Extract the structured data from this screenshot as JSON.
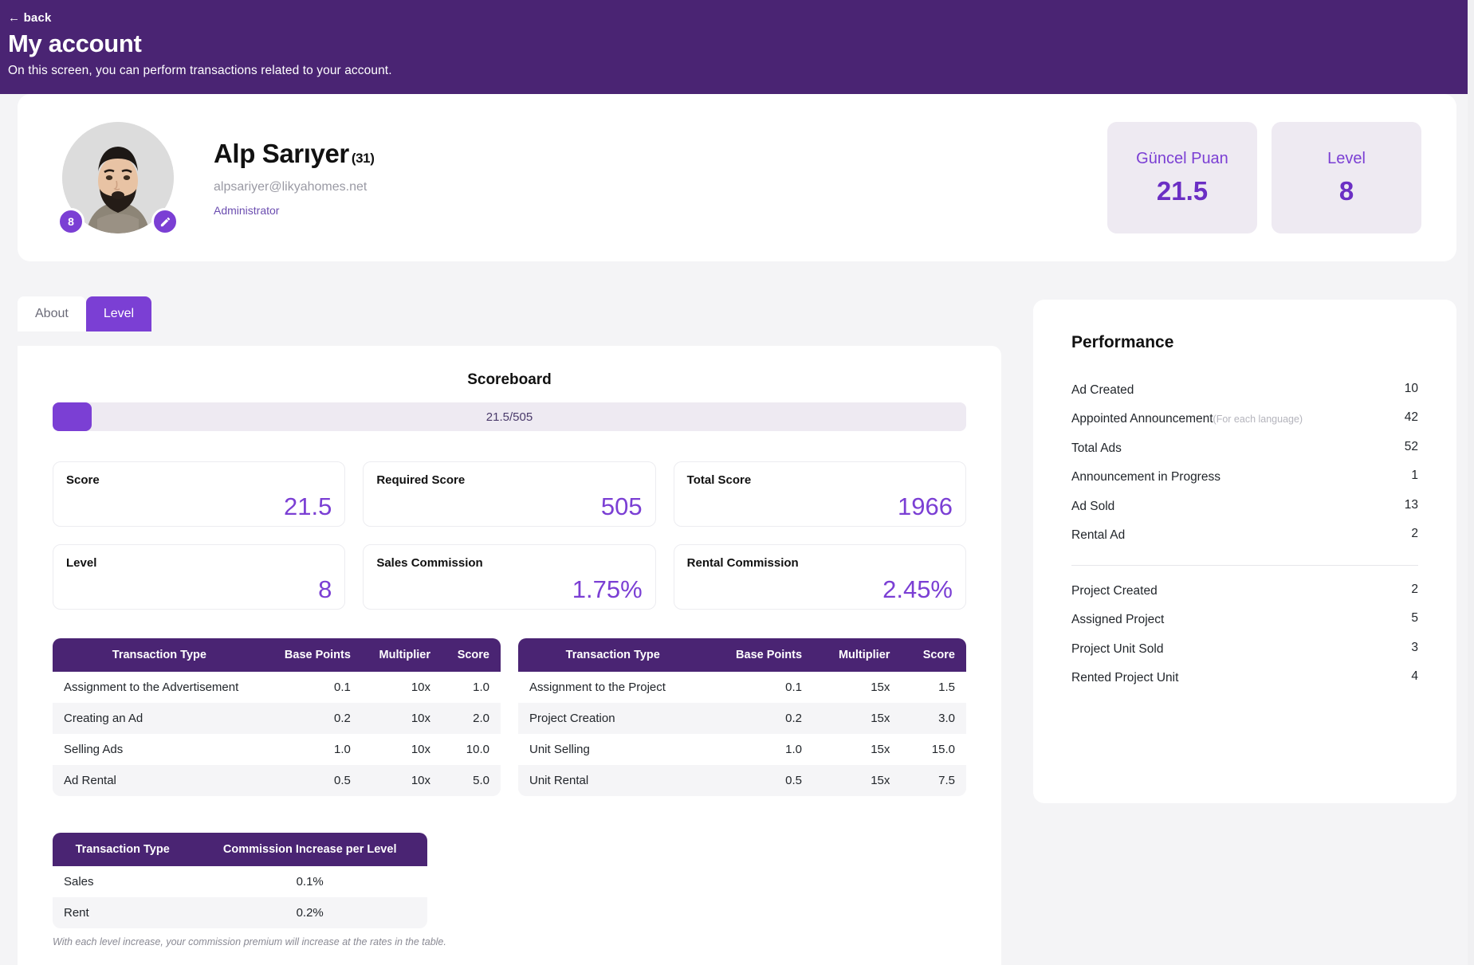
{
  "header": {
    "back_label": "← back",
    "title": "My account",
    "subtitle": "On this screen, you can perform transactions related to your account."
  },
  "profile": {
    "name": "Alp Sarıyer",
    "age": "(31)",
    "email": "alpsariyer@likyahomes.net",
    "role": "Administrator",
    "level_badge": "8",
    "edit_icon": "pencil-icon",
    "metrics": [
      {
        "label": "Güncel Puan",
        "value": "21.5"
      },
      {
        "label": "Level",
        "value": "8"
      }
    ]
  },
  "tabs": [
    {
      "label": "About",
      "active": false
    },
    {
      "label": "Level",
      "active": true
    }
  ],
  "scoreboard": {
    "title": "Scoreboard",
    "progress_text": "21.5/505",
    "progress_current": 21.5,
    "progress_max": 505,
    "stats": [
      {
        "label": "Score",
        "value": "21.5"
      },
      {
        "label": "Required Score",
        "value": "505"
      },
      {
        "label": "Total Score",
        "value": "1966"
      },
      {
        "label": "Level",
        "value": "8"
      },
      {
        "label": "Sales Commission",
        "value": "1.75%"
      },
      {
        "label": "Rental Commission",
        "value": "2.45%"
      }
    ]
  },
  "ad_table": {
    "columns": [
      "Transaction Type",
      "Base Points",
      "Multiplier",
      "Score"
    ],
    "rows": [
      [
        "Assignment to the Advertisement",
        "0.1",
        "10x",
        "1.0"
      ],
      [
        "Creating an Ad",
        "0.2",
        "10x",
        "2.0"
      ],
      [
        "Selling Ads",
        "1.0",
        "10x",
        "10.0"
      ],
      [
        "Ad Rental",
        "0.5",
        "10x",
        "5.0"
      ]
    ]
  },
  "project_table": {
    "columns": [
      "Transaction Type",
      "Base Points",
      "Multiplier",
      "Score"
    ],
    "rows": [
      [
        "Assignment to the Project",
        "0.1",
        "15x",
        "1.5"
      ],
      [
        "Project Creation",
        "0.2",
        "15x",
        "3.0"
      ],
      [
        "Unit Selling",
        "1.0",
        "15x",
        "15.0"
      ],
      [
        "Unit Rental",
        "0.5",
        "15x",
        "7.5"
      ]
    ]
  },
  "commission_table": {
    "columns": [
      "Transaction Type",
      "Commission Increase per Level"
    ],
    "rows": [
      [
        "Sales",
        "0.1%"
      ],
      [
        "Rent",
        "0.2%"
      ]
    ],
    "note": "With each level increase, your commission premium will increase at the rates in the table."
  },
  "performance": {
    "title": "Performance",
    "group_one": [
      {
        "label": "Ad Created",
        "sub": "",
        "value": "10"
      },
      {
        "label": "Appointed Announcement",
        "sub": "(For each language)",
        "value": "42"
      },
      {
        "label": "Total Ads",
        "sub": "",
        "value": "52"
      },
      {
        "label": "Announcement in Progress",
        "sub": "",
        "value": "1"
      },
      {
        "label": "Ad Sold",
        "sub": "",
        "value": "13"
      },
      {
        "label": "Rental Ad",
        "sub": "",
        "value": "2"
      }
    ],
    "group_two": [
      {
        "label": "Project Created",
        "sub": "",
        "value": "2"
      },
      {
        "label": "Assigned Project",
        "sub": "",
        "value": "5"
      },
      {
        "label": "Project Unit Sold",
        "sub": "",
        "value": "3"
      },
      {
        "label": "Rented Project Unit",
        "sub": "",
        "value": "4"
      }
    ]
  },
  "colors": {
    "header_purple": "#4a2473",
    "accent_purple": "#7b3fd4",
    "value_purple": "#6b2fc4",
    "chip_bg": "#eeeaf2",
    "page_bg": "#f4f4f6"
  }
}
